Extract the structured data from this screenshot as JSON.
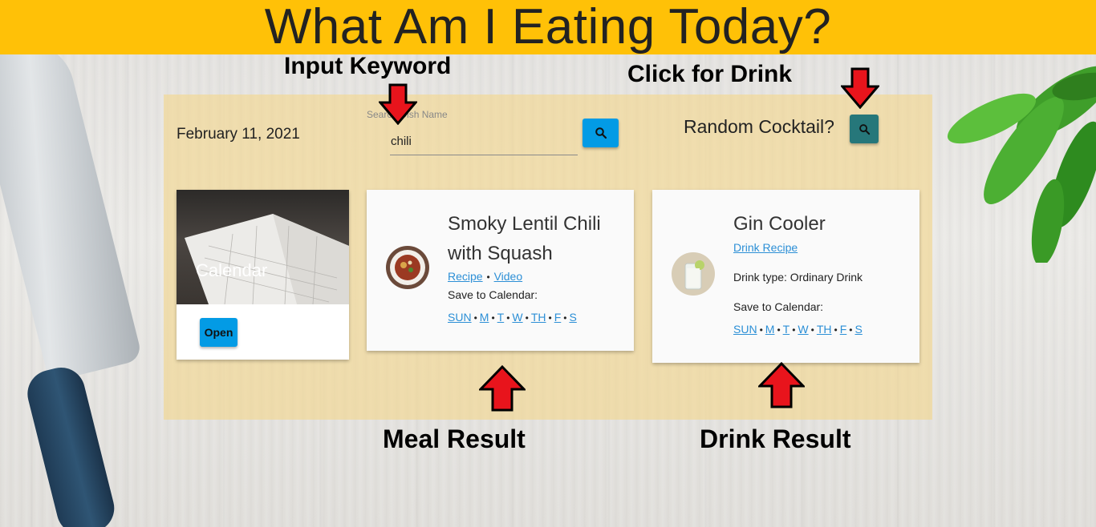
{
  "header": {
    "title": "What Am I Eating Today?"
  },
  "date": "February 11, 2021",
  "search": {
    "label": "Search Dish Name",
    "value": "chili",
    "button_icon": "search-icon"
  },
  "cocktail": {
    "label": "Random Cocktail?",
    "button_icon": "search-icon"
  },
  "calendar_card": {
    "title": "Calendar",
    "button_label": "Open"
  },
  "meal_card": {
    "title_line1": "Smoky Lentil Chili",
    "title_line2": "with Squash",
    "recipe_link": "Recipe",
    "separator": "•",
    "video_link": "Video",
    "save_label": "Save to Calendar:",
    "days": [
      "SUN",
      "M",
      "T",
      "W",
      "TH",
      "F",
      "S"
    ]
  },
  "drink_card": {
    "title": "Gin Cooler",
    "recipe_link": "Drink Recipe",
    "drink_type": "Drink type: Ordinary Drink",
    "save_label": "Save to Calendar:",
    "days": [
      "SUN",
      "M",
      "T",
      "W",
      "TH",
      "F",
      "S"
    ]
  },
  "annotations": {
    "input_keyword": "Input Keyword",
    "click_for_drink": "Click for Drink",
    "meal_result": "Meal Result",
    "drink_result": "Drink Result"
  },
  "colors": {
    "banner": "#ffc107",
    "primary_button": "#039be5",
    "cocktail_button": "#26777a",
    "link": "#2c8fd6",
    "arrow": "#e8141c"
  }
}
